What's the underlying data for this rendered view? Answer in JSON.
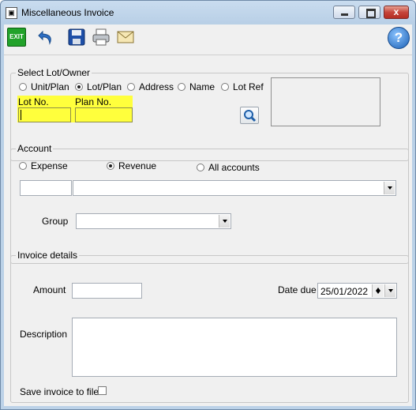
{
  "window": {
    "title": "Miscellaneous Invoice",
    "close_glyph": "x"
  },
  "toolbar": {
    "exit_label": "EXIT",
    "icons": [
      "exit-icon",
      "undo-icon",
      "save-icon",
      "print-icon",
      "email-icon",
      "help-icon"
    ],
    "help_glyph": "?"
  },
  "select_lot": {
    "legend": "Select Lot/Owner",
    "options": [
      "Unit/Plan",
      "Lot/Plan",
      "Address",
      "Name",
      "Lot Ref"
    ],
    "selected": "Lot/Plan",
    "lot_no_label": "Lot No.",
    "plan_no_label": "Plan No.",
    "lot_no_value": "",
    "plan_no_value": "",
    "highlight_color": "#ffff3c"
  },
  "account": {
    "legend": "Account",
    "options": [
      "Expense",
      "Revenue",
      "All accounts"
    ],
    "selected": "Revenue",
    "code_value": "",
    "account_value": "",
    "group_label": "Group",
    "group_value": ""
  },
  "invoice": {
    "legend": "Invoice details",
    "amount_label": "Amount",
    "amount_value": "",
    "date_due_label": "Date due",
    "date_due_value": "25/01/2022",
    "description_label": "Description",
    "description_value": "",
    "save_to_file_label": "Save invoice to file",
    "save_to_file_checked": false
  }
}
